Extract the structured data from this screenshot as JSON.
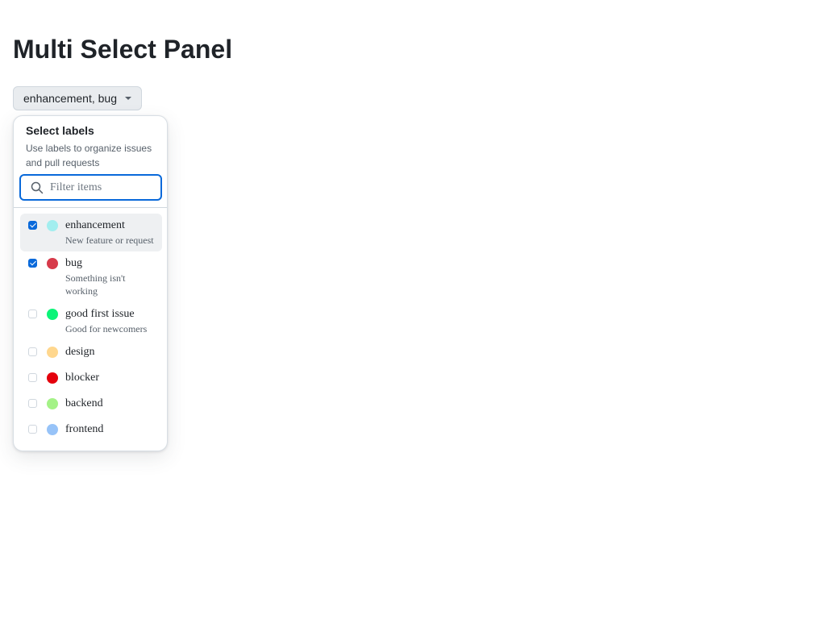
{
  "page": {
    "title": "Multi Select Panel"
  },
  "trigger": {
    "label": "enhancement, bug"
  },
  "panel": {
    "title": "Select labels",
    "subtitle": "Use labels to organize issues and pull requests",
    "filter_placeholder": "Filter items",
    "items": [
      {
        "label": "enhancement",
        "description": "New feature or request",
        "checked": true,
        "color": "#a2eeef"
      },
      {
        "label": "bug",
        "description": "Something isn't working",
        "checked": true,
        "color": "#d73a4a"
      },
      {
        "label": "good first issue",
        "description": "Good for newcomers",
        "checked": false,
        "color": "#0cf478"
      },
      {
        "label": "design",
        "description": "",
        "checked": false,
        "color": "#ffd78e"
      },
      {
        "label": "blocker",
        "description": "",
        "checked": false,
        "color": "#e4000c"
      },
      {
        "label": "backend",
        "description": "",
        "checked": false,
        "color": "#a4f287"
      },
      {
        "label": "frontend",
        "description": "",
        "checked": false,
        "color": "#97c3f8"
      }
    ]
  },
  "colors": {
    "accent": "#0969da",
    "text": "#1f2328",
    "muted": "#57606a",
    "active_bg": "#eef0f2"
  }
}
